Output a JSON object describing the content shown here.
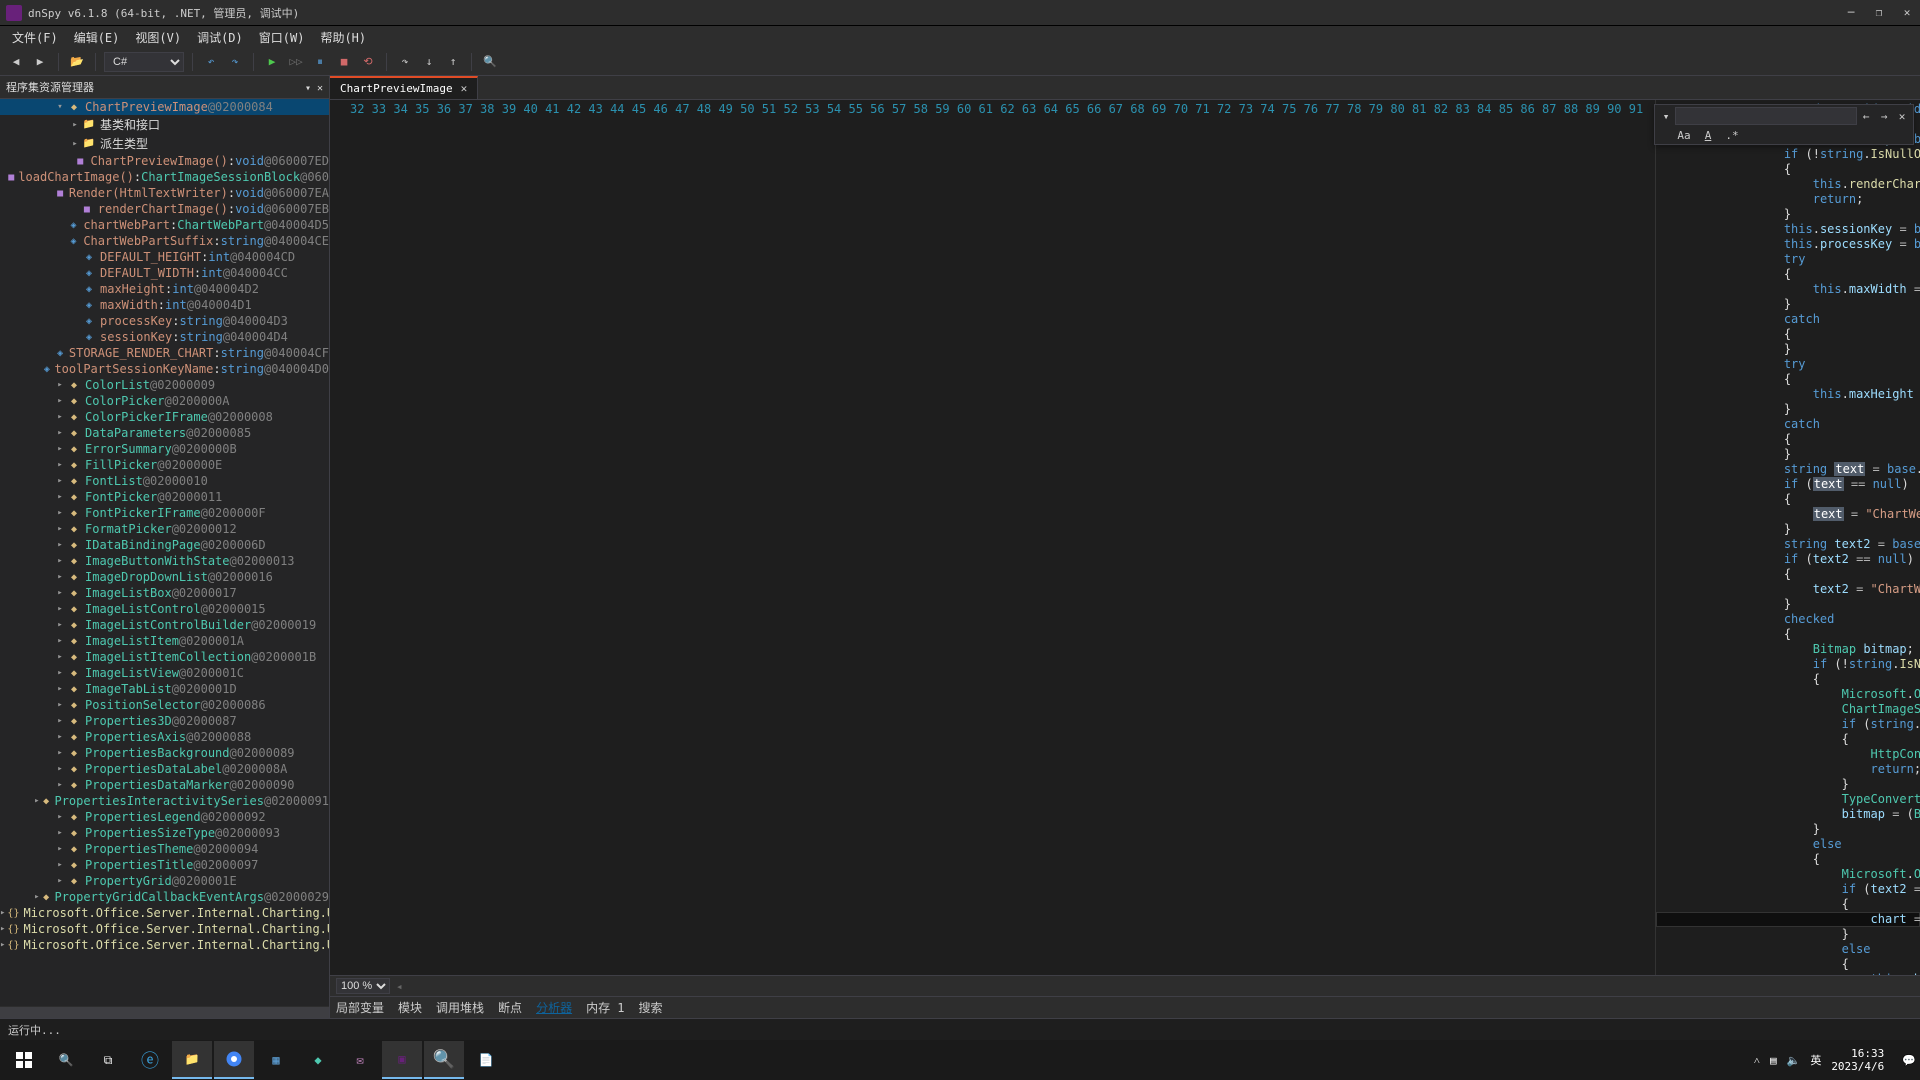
{
  "title_bar": "dnSpy v6.1.8 (64-bit, .NET, 管理员, 调试中)",
  "win_min": "─",
  "win_max": "❐",
  "win_close": "✕",
  "menu": [
    "文件(F)",
    "编辑(E)",
    "视图(V)",
    "调试(D)",
    "窗口(W)",
    "帮助(H)"
  ],
  "toolbar_combo": "C#",
  "sidebar_title": "程序集资源管理器",
  "tree": {
    "main_class": {
      "name": "ChartPreviewImage",
      "token": "@02000084"
    },
    "sub_base": "基类和接口",
    "sub_derived": "派生类型",
    "members": [
      {
        "name": "ChartPreviewImage()",
        "ret": "void",
        "tok": "@060007ED"
      },
      {
        "name": "loadChartImage()",
        "ret": "ChartImageSessionBlock",
        "tok": "@060"
      },
      {
        "name": "Render(HtmlTextWriter)",
        "ret": "void",
        "tok": "@060007EA"
      },
      {
        "name": "renderChartImage()",
        "ret": "void",
        "tok": "@060007EB"
      },
      {
        "name": "chartWebPart",
        "ret": "ChartWebPart",
        "tok": "@040004D5"
      },
      {
        "name": "ChartWebPartSuffix",
        "ret": "string",
        "tok": "@040004CE"
      },
      {
        "name": "DEFAULT_HEIGHT",
        "ret": "int",
        "tok": "@040004CD"
      },
      {
        "name": "DEFAULT_WIDTH",
        "ret": "int",
        "tok": "@040004CC"
      },
      {
        "name": "maxHeight",
        "ret": "int",
        "tok": "@040004D2"
      },
      {
        "name": "maxWidth",
        "ret": "int",
        "tok": "@040004D1"
      },
      {
        "name": "processKey",
        "ret": "string",
        "tok": "@040004D3"
      },
      {
        "name": "sessionKey",
        "ret": "string",
        "tok": "@040004D4"
      },
      {
        "name": "STORAGE_RENDER_CHART",
        "ret": "string",
        "tok": "@040004CF"
      },
      {
        "name": "toolPartSessionKeyName",
        "ret": "string",
        "tok": "@040004D0"
      }
    ],
    "siblings": [
      {
        "name": "ColorList",
        "tok": "@02000009"
      },
      {
        "name": "ColorPicker",
        "tok": "@0200000A"
      },
      {
        "name": "ColorPickerIFrame",
        "tok": "@02000008"
      },
      {
        "name": "DataParameters",
        "tok": "@02000085"
      },
      {
        "name": "ErrorSummary",
        "tok": "@0200000B"
      },
      {
        "name": "FillPicker",
        "tok": "@0200000E"
      },
      {
        "name": "FontList",
        "tok": "@02000010"
      },
      {
        "name": "FontPicker",
        "tok": "@02000011"
      },
      {
        "name": "FontPickerIFrame",
        "tok": "@0200000F"
      },
      {
        "name": "FormatPicker",
        "tok": "@02000012"
      },
      {
        "name": "IDataBindingPage",
        "tok": "@0200006D"
      },
      {
        "name": "ImageButtonWithState",
        "tok": "@02000013"
      },
      {
        "name": "ImageDropDownList",
        "tok": "@02000016"
      },
      {
        "name": "ImageListBox",
        "tok": "@02000017"
      },
      {
        "name": "ImageListControl",
        "tok": "@02000015"
      },
      {
        "name": "ImageListControlBuilder",
        "tok": "@02000019"
      },
      {
        "name": "ImageListItem",
        "tok": "@0200001A"
      },
      {
        "name": "ImageListItemCollection",
        "tok": "@0200001B"
      },
      {
        "name": "ImageListView",
        "tok": "@0200001C"
      },
      {
        "name": "ImageTabList",
        "tok": "@0200001D"
      },
      {
        "name": "PositionSelector",
        "tok": "@02000086"
      },
      {
        "name": "Properties3D",
        "tok": "@02000087"
      },
      {
        "name": "PropertiesAxis",
        "tok": "@02000088"
      },
      {
        "name": "PropertiesBackground",
        "tok": "@02000089"
      },
      {
        "name": "PropertiesDataLabel",
        "tok": "@0200008A"
      },
      {
        "name": "PropertiesDataMarker",
        "tok": "@02000090"
      },
      {
        "name": "PropertiesInteractivitySeries",
        "tok": "@02000091"
      },
      {
        "name": "PropertiesLegend",
        "tok": "@02000092"
      },
      {
        "name": "PropertiesSizeType",
        "tok": "@02000093"
      },
      {
        "name": "PropertiesTheme",
        "tok": "@02000094"
      },
      {
        "name": "PropertiesTitle",
        "tok": "@02000097"
      },
      {
        "name": "PropertyGrid",
        "tok": "@0200001E"
      },
      {
        "name": "PropertyGridCallbackEventArgs",
        "tok": "@02000029"
      }
    ],
    "ns": [
      "Microsoft.Office.Server.Internal.Charting.UI.WebControls.",
      "Microsoft.Office.Server.Internal.Charting.UI.WebControls.",
      "Microsoft.Office.Server.Internal.Charting.UI.WebControls."
    ]
  },
  "tab_name": "ChartPreviewImage",
  "zoom": "100 %",
  "bottom_tabs": [
    "局部变量",
    "模块",
    "调用堆栈",
    "断点",
    "分析器",
    "内存 1",
    "搜索"
  ],
  "bottom_active": 4,
  "run_status": "运行中...",
  "clock": {
    "time": "16:33",
    "date": "2023/4/6"
  },
  "tray_lang": "英",
  "first_line": 32,
  "current_line": 86
}
